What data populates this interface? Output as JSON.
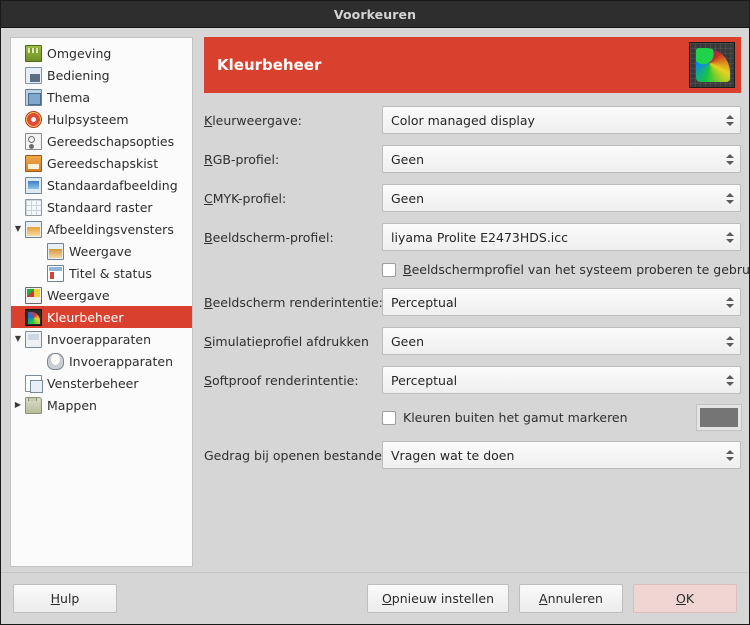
{
  "window": {
    "title": "Voorkeuren"
  },
  "sidebar": {
    "items": [
      {
        "label": "Omgeving",
        "icon": "environment-icon",
        "indent": 0,
        "expander": "",
        "selected": false,
        "icon_class": "ic-env"
      },
      {
        "label": "Bediening",
        "icon": "interface-icon",
        "indent": 0,
        "expander": "",
        "selected": false,
        "icon_class": "ic-bed"
      },
      {
        "label": "Thema",
        "icon": "theme-icon",
        "indent": 0,
        "expander": "",
        "selected": false,
        "icon_class": "ic-them"
      },
      {
        "label": "Hulpsysteem",
        "icon": "lifebuoy-icon",
        "indent": 0,
        "expander": "",
        "selected": false,
        "icon_class": "ic-help"
      },
      {
        "label": "Gereedschapsopties",
        "icon": "tool-options-icon",
        "indent": 0,
        "expander": "",
        "selected": false,
        "icon_class": "ic-tool"
      },
      {
        "label": "Gereedschapskist",
        "icon": "toolbox-icon",
        "indent": 0,
        "expander": "",
        "selected": false,
        "icon_class": "ic-box"
      },
      {
        "label": "Standaardafbeelding",
        "icon": "default-image-icon",
        "indent": 0,
        "expander": "",
        "selected": false,
        "icon_class": "ic-img"
      },
      {
        "label": "Standaard raster",
        "icon": "grid-icon",
        "indent": 0,
        "expander": "",
        "selected": false,
        "icon_class": "ic-grid"
      },
      {
        "label": "Afbeeldingsvensters",
        "icon": "image-windows-icon",
        "indent": 0,
        "expander": "▼",
        "selected": false,
        "icon_class": "ic-win"
      },
      {
        "label": "Weergave",
        "icon": "appearance-icon",
        "indent": 1,
        "expander": "",
        "selected": false,
        "icon_class": "ic-view"
      },
      {
        "label": "Titel & status",
        "icon": "title-status-icon",
        "indent": 1,
        "expander": "",
        "selected": false,
        "icon_class": "ic-title"
      },
      {
        "label": "Weergave",
        "icon": "display-icon",
        "indent": 0,
        "expander": "",
        "selected": false,
        "icon_class": "ic-disp"
      },
      {
        "label": "Kleurbeheer",
        "icon": "color-management-icon",
        "indent": 0,
        "expander": "",
        "selected": true,
        "icon_class": "ic-color"
      },
      {
        "label": "Invoerapparaten",
        "icon": "input-devices-icon",
        "indent": 0,
        "expander": "▼",
        "selected": false,
        "icon_class": "ic-inp"
      },
      {
        "label": "Invoerapparaten",
        "icon": "mouse-icon",
        "indent": 1,
        "expander": "",
        "selected": false,
        "icon_class": "ic-mouse"
      },
      {
        "label": "Vensterbeheer",
        "icon": "window-manager-icon",
        "indent": 0,
        "expander": "",
        "selected": false,
        "icon_class": "ic-wm"
      },
      {
        "label": "Mappen",
        "icon": "folder-icon",
        "indent": 0,
        "expander": "▶",
        "selected": false,
        "icon_class": "ic-fold"
      }
    ]
  },
  "panel": {
    "title": "Kleurbeheer",
    "icon": "color-gamut-icon",
    "accent_color": "#d9412e",
    "rows": [
      {
        "kind": "combo",
        "name": "color-display-mode",
        "mnemonic": "K",
        "label_rest": "leurweergave:",
        "value": "Color managed display"
      },
      {
        "kind": "combo",
        "name": "rgb-profile",
        "mnemonic": "R",
        "label_rest": "GB-profiel:",
        "value": "Geen"
      },
      {
        "kind": "combo",
        "name": "cmyk-profile",
        "mnemonic": "C",
        "label_rest": "MYK-profiel:",
        "value": "Geen"
      },
      {
        "kind": "combo",
        "name": "monitor-profile",
        "mnemonic": "B",
        "label_rest": "eeldscherm-profiel:",
        "value": "liyama Prolite E2473HDS.icc"
      },
      {
        "kind": "check",
        "name": "use-system-monitor-profile",
        "mnemonic": "B",
        "label_rest": "eeldschermprofiel van het systeem proberen te gebruiken",
        "checked": false
      },
      {
        "kind": "combo",
        "name": "display-rendering-intent",
        "mnemonic": "B",
        "label_rest": "eeldscherm renderintentie:",
        "value": "Perceptual"
      },
      {
        "kind": "combo",
        "name": "print-simulation-profile",
        "mnemonic": "S",
        "label_rest": "imulatieprofiel afdrukken",
        "value": "Geen"
      },
      {
        "kind": "combo",
        "name": "softproof-rendering-intent",
        "mnemonic": "S",
        "label_rest": "oftproof renderintentie:",
        "value": "Perceptual"
      },
      {
        "kind": "check-swatch",
        "name": "mark-out-of-gamut",
        "mnemonic": "",
        "label_rest": "Kleuren buiten het gamut markeren",
        "checked": false,
        "swatch_color": "#757575"
      },
      {
        "kind": "combo",
        "name": "file-open-behaviour",
        "mnemonic": "",
        "label_rest": "Gedrag bij openen bestanden:",
        "value": "Vragen wat te doen"
      }
    ]
  },
  "footer": {
    "help": {
      "mnemonic": "H",
      "rest": "ulp"
    },
    "reset": {
      "mnemonic": "O",
      "rest": "pnieuw instellen"
    },
    "cancel": {
      "mnemonic": "A",
      "rest": "nnuleren"
    },
    "ok": {
      "mnemonic": "O",
      "rest": "K"
    }
  }
}
